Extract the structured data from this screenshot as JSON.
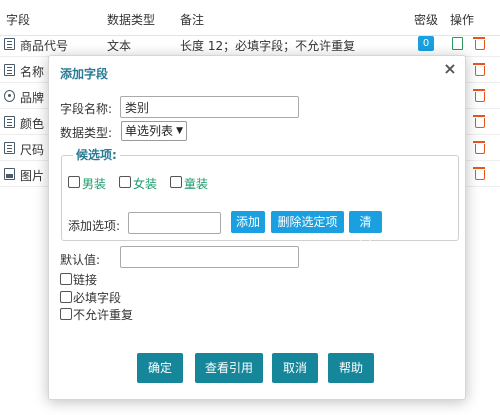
{
  "table": {
    "headers": [
      "字段",
      "数据类型",
      "备注",
      "密级",
      "操作"
    ],
    "rows": [
      {
        "field": "商品代号",
        "type": "文本",
        "note": "长度 12；必填字段；不允许重复",
        "level": "0"
      },
      {
        "field": "名称"
      },
      {
        "field": "品牌"
      },
      {
        "field": "颜色"
      },
      {
        "field": "尺码"
      },
      {
        "field": "图片"
      }
    ]
  },
  "dialog": {
    "title": "添加字段",
    "close": "×",
    "field_name_label": "字段名称:",
    "field_name_value": "类别",
    "data_type_label": "数据类型:",
    "data_type_value": "单选列表",
    "options_legend": "候选项:",
    "options": [
      "男装",
      "女装",
      "童装"
    ],
    "add_option_label": "添加选项:",
    "add_option_value": "",
    "btn_add": "添加",
    "btn_delete_selected": "删除选定项",
    "btn_clear": "清空",
    "default_label": "默认值:",
    "default_value": "",
    "cb_link": "链接",
    "cb_required": "必填字段",
    "cb_unique": "不允许重复",
    "btn_ok": "确定",
    "btn_view_refs": "查看引用",
    "btn_cancel": "取消",
    "btn_help": "帮助"
  },
  "colors": {
    "accent_blue": "#1aa0e0",
    "accent_teal": "#16869a",
    "title_teal": "#2a7a95",
    "option_green": "#1a9a6a",
    "delete_red": "#e8541e"
  }
}
